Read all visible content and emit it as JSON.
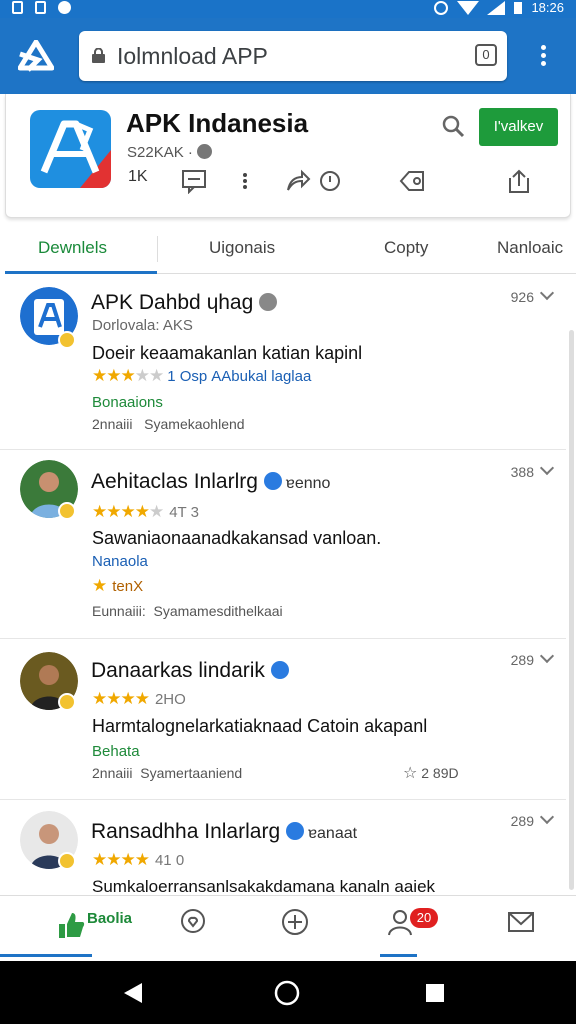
{
  "statusbar": {
    "time": "18:26"
  },
  "browser": {
    "url_text": "Iolmnload APP",
    "tab_count": "0"
  },
  "app": {
    "title": "APK Indanesia",
    "subtitle": "S22KAK ·",
    "install_label": "I'valkev",
    "actions": {
      "count": "1K"
    }
  },
  "tabs": [
    {
      "label": "Dewnlels",
      "active": true
    },
    {
      "label": "Uigonais",
      "active": false
    },
    {
      "label": "Copty",
      "active": false
    },
    {
      "label": "Nanloaic",
      "active": false
    }
  ],
  "reviews": [
    {
      "name": "APK Dahbd ɥhaɡ",
      "count": "926",
      "meta": "Dorlovala: AKS",
      "body": "Doeir keaamakanlan katian kapinl",
      "rating": 3,
      "stars_text": "1 Osp",
      "stars_link": "AAbukal laglaa",
      "green": "Bonaaions",
      "footer_left": "2nnaiii",
      "footer_right_text": "Syamekaohlend"
    },
    {
      "name": "Aehitaclas Inlarlrg",
      "verified_text": "ɐenno",
      "count": "388",
      "stars_text": "4T 3",
      "rating": 3.5,
      "body": "Sawaniaonaanadkakansad vanloan.",
      "blue": "Nanaola",
      "badge_text": "tenX",
      "footer_left": "Eunnaiii:",
      "footer_right_text": "Syamamesdithelkaai"
    },
    {
      "name": "Danaarkas lindarik",
      "count": "289",
      "stars_text": "2HO",
      "rating": 4,
      "body": "Harmtalognelarkatiaknaad Catoin akapanl",
      "green": "Behata",
      "footer_left": "2nnaiii",
      "footer_right_text": "Syamertaaniend",
      "footer_end": "2 89D"
    },
    {
      "name": "Ransadhha Inlarlarg",
      "verified_text": "ɐanaat",
      "count": "289",
      "stars_text": "41 0",
      "rating": 4,
      "body": "Sumkaloerransanlsakakdamana kanaln aaiek"
    }
  ],
  "bottomnav": {
    "first_label": "Baolia",
    "notif_count": "20"
  },
  "colors": {
    "primary": "#1e74c6",
    "accent": "#1e9b3b",
    "star": "#f0a800"
  }
}
